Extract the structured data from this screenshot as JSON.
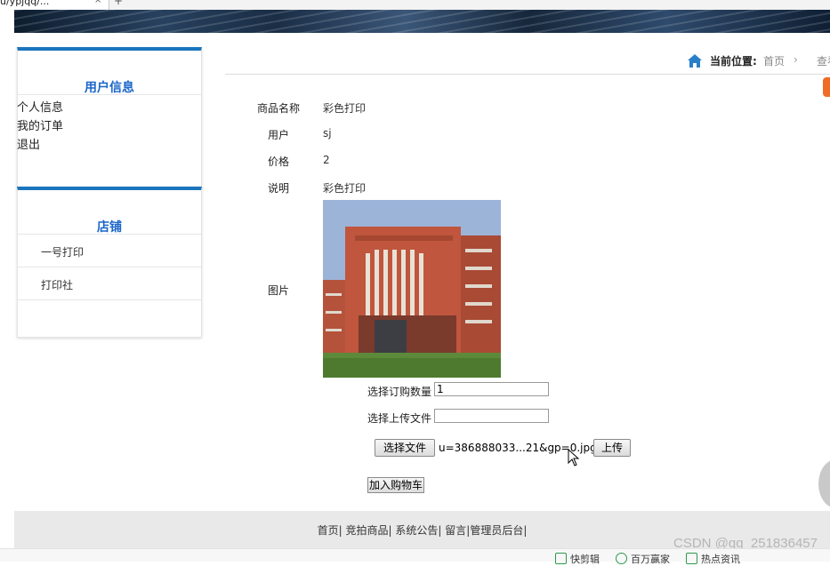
{
  "browser": {
    "tab_title": "u/ypjqq/...",
    "tab_close": "×",
    "new_tab": "+"
  },
  "sidebar": {
    "user_panel": {
      "title": "用户信息",
      "links": [
        "个人信息",
        "我的订单",
        "退出"
      ]
    },
    "shop_panel": {
      "title": "店铺",
      "shops": [
        "一号打印",
        "打印社"
      ]
    }
  },
  "breadcrumb": {
    "label": "当前位置:",
    "home": "首页",
    "separator": "›",
    "next": "查看"
  },
  "product": {
    "fields": [
      {
        "label": "商品名称",
        "value": "彩色打印"
      },
      {
        "label": "用户",
        "value": "sj"
      },
      {
        "label": "价格",
        "value": "2"
      },
      {
        "label": "说明",
        "value": "彩色打印"
      }
    ],
    "image_label": "图片",
    "image_icon": "building-photo"
  },
  "order_form": {
    "quantity_label": "选择订购数量",
    "quantity_value": "1",
    "upload_label": "选择上传文件",
    "upload_value": "",
    "choose_file_button": "选择文件",
    "chosen_file_name": "u=386888033...21&gp=0.jpg",
    "upload_button": "上传",
    "add_to_cart_button": "加入购物车"
  },
  "footer": {
    "links": [
      "首页",
      "竞拍商品",
      "系统公告",
      "留言",
      "管理员后台"
    ]
  },
  "watermark": "CSDN @qq_251836457",
  "taskbar": {
    "items": [
      "快剪辑",
      "百万赢家",
      "热点资讯"
    ]
  },
  "colors": {
    "accent_blue": "#1b75bd",
    "title_blue": "#1b66c9",
    "footer_bg": "#e9e9e9"
  }
}
